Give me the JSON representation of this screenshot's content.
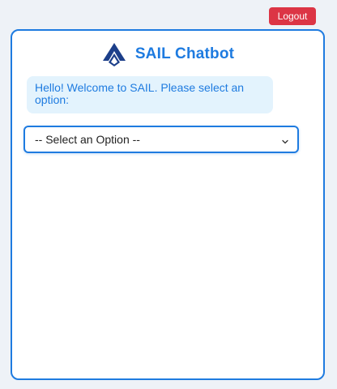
{
  "header": {
    "logout_label": "Logout"
  },
  "chat": {
    "title": "SAIL Chatbot",
    "logo_icon": "sail-logo-icon",
    "welcome_message": "Hello! Welcome to SAIL. Please select an option:",
    "select": {
      "selected_value": "-- Select an Option --"
    }
  },
  "colors": {
    "accent": "#1e7be0",
    "logout": "#dc3545",
    "bubble_bg": "#e3f3fd",
    "page_bg": "#eef2f7",
    "logo": "#1c3f8a"
  }
}
